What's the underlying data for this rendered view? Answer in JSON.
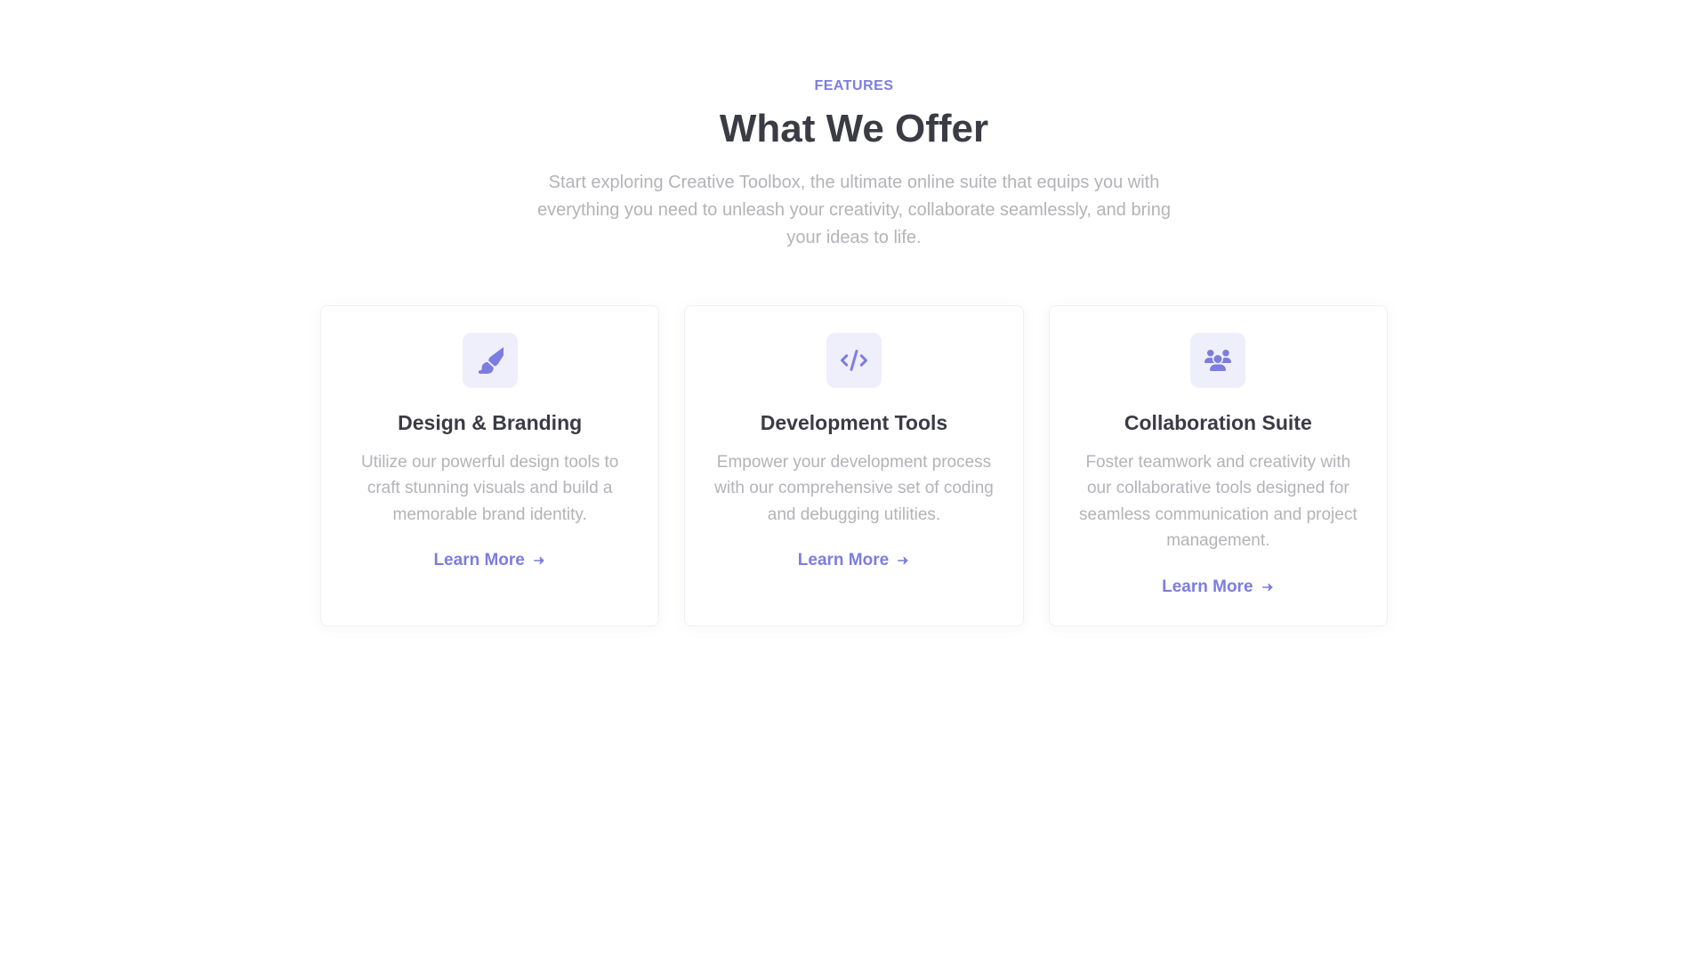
{
  "header": {
    "eyebrow": "FEATURES",
    "title": "What We Offer",
    "subtitle": "Start exploring Creative Toolbox, the ultimate online suite that equips you with everything you need to unleash your creativity, collaborate seamlessly, and bring your ideas to life."
  },
  "cards": [
    {
      "icon": "paint-brush",
      "title": "Design & Branding",
      "desc": "Utilize our powerful design tools to craft stunning visuals and build a memorable brand identity.",
      "cta": "Learn More"
    },
    {
      "icon": "code",
      "title": "Development Tools",
      "desc": "Empower your development process with our comprehensive set of coding and debugging utilities.",
      "cta": "Learn More"
    },
    {
      "icon": "users",
      "title": "Collaboration Suite",
      "desc": "Foster teamwork and creativity with our collaborative tools designed for seamless communication and project management.",
      "cta": "Learn More"
    }
  ],
  "colors": {
    "accent": "#7c7de0"
  }
}
